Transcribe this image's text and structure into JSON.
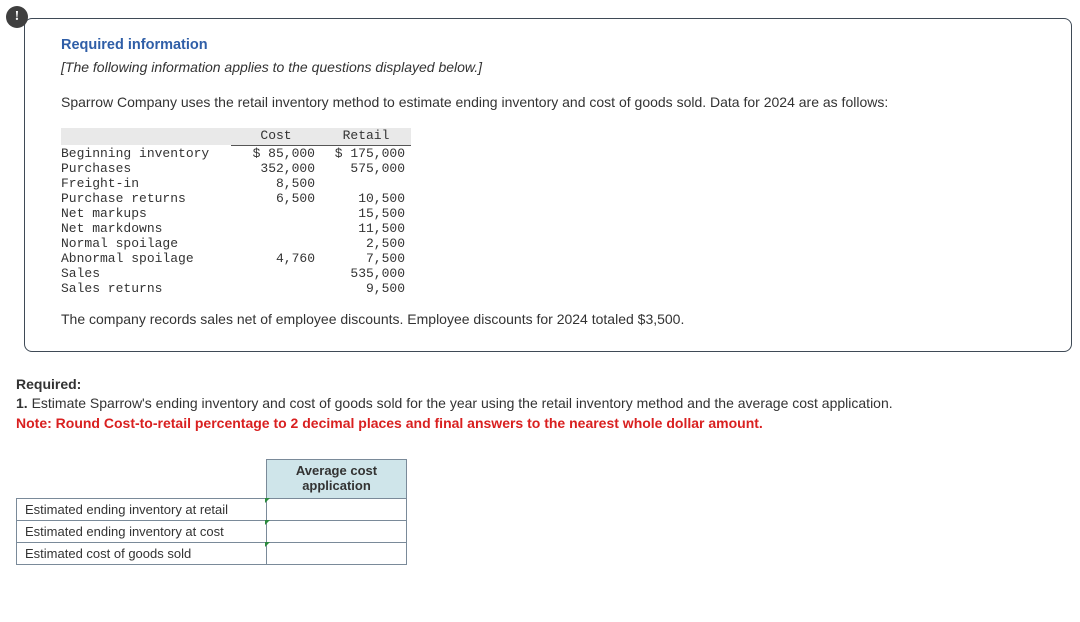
{
  "icon_char": "!",
  "heading": "Required information",
  "italic_note": "[The following information applies to the questions displayed below.]",
  "intro": "Sparrow Company uses the retail inventory method to estimate ending inventory and cost of goods sold. Data for 2024 are as follows:",
  "headers": {
    "cost": "Cost",
    "retail": "Retail"
  },
  "rows": [
    {
      "label": "Beginning inventory",
      "cost": "$ 85,000",
      "retail": "$ 175,000"
    },
    {
      "label": "Purchases",
      "cost": "352,000",
      "retail": "575,000"
    },
    {
      "label": "Freight-in",
      "cost": "8,500",
      "retail": ""
    },
    {
      "label": "Purchase returns",
      "cost": "6,500",
      "retail": "10,500"
    },
    {
      "label": "Net markups",
      "cost": "",
      "retail": "15,500"
    },
    {
      "label": "Net markdowns",
      "cost": "",
      "retail": "11,500"
    },
    {
      "label": "Normal spoilage",
      "cost": "",
      "retail": "2,500"
    },
    {
      "label": "Abnormal spoilage",
      "cost": "4,760",
      "retail": "7,500"
    },
    {
      "label": "Sales",
      "cost": "",
      "retail": "535,000"
    },
    {
      "label": "Sales returns",
      "cost": "",
      "retail": "9,500"
    }
  ],
  "post_table": "The company records sales net of employee discounts. Employee discounts for 2024 totaled $3,500.",
  "required_heading": "Required:",
  "required_num": "1.",
  "required_text": " Estimate Sparrow's ending inventory and cost of goods sold for the year using the retail inventory method and the average cost application.",
  "note_red": "Note: Round Cost-to-retail percentage to 2 decimal places and final answers to the nearest whole dollar amount.",
  "answer_header": "Average cost application",
  "answer_rows": [
    "Estimated ending inventory at retail",
    "Estimated ending inventory at cost",
    "Estimated cost of goods sold"
  ],
  "chart_data": {
    "type": "table",
    "title": "Retail inventory method data for 2024",
    "columns": [
      "Item",
      "Cost",
      "Retail"
    ],
    "rows": [
      [
        "Beginning inventory",
        85000,
        175000
      ],
      [
        "Purchases",
        352000,
        575000
      ],
      [
        "Freight-in",
        8500,
        null
      ],
      [
        "Purchase returns",
        6500,
        10500
      ],
      [
        "Net markups",
        null,
        15500
      ],
      [
        "Net markdowns",
        null,
        11500
      ],
      [
        "Normal spoilage",
        null,
        2500
      ],
      [
        "Abnormal spoilage",
        4760,
        7500
      ],
      [
        "Sales",
        null,
        535000
      ],
      [
        "Sales returns",
        null,
        9500
      ]
    ]
  }
}
